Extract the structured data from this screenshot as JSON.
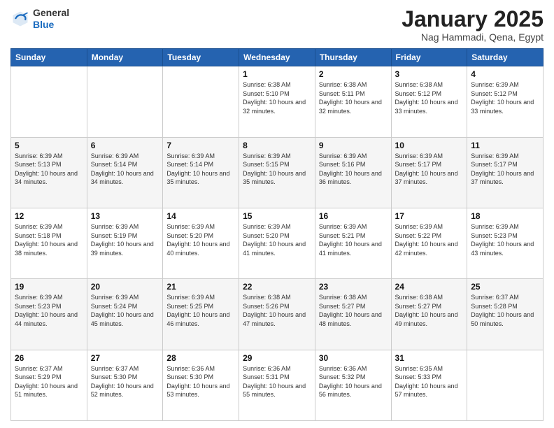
{
  "logo": {
    "general": "General",
    "blue": "Blue"
  },
  "header": {
    "month_year": "January 2025",
    "location": "Nag Hammadi, Qena, Egypt"
  },
  "weekdays": [
    "Sunday",
    "Monday",
    "Tuesday",
    "Wednesday",
    "Thursday",
    "Friday",
    "Saturday"
  ],
  "weeks": [
    [
      {
        "day": "",
        "sunrise": "",
        "sunset": "",
        "daylight": ""
      },
      {
        "day": "",
        "sunrise": "",
        "sunset": "",
        "daylight": ""
      },
      {
        "day": "",
        "sunrise": "",
        "sunset": "",
        "daylight": ""
      },
      {
        "day": "1",
        "sunrise": "Sunrise: 6:38 AM",
        "sunset": "Sunset: 5:10 PM",
        "daylight": "Daylight: 10 hours and 32 minutes."
      },
      {
        "day": "2",
        "sunrise": "Sunrise: 6:38 AM",
        "sunset": "Sunset: 5:11 PM",
        "daylight": "Daylight: 10 hours and 32 minutes."
      },
      {
        "day": "3",
        "sunrise": "Sunrise: 6:38 AM",
        "sunset": "Sunset: 5:12 PM",
        "daylight": "Daylight: 10 hours and 33 minutes."
      },
      {
        "day": "4",
        "sunrise": "Sunrise: 6:39 AM",
        "sunset": "Sunset: 5:12 PM",
        "daylight": "Daylight: 10 hours and 33 minutes."
      }
    ],
    [
      {
        "day": "5",
        "sunrise": "Sunrise: 6:39 AM",
        "sunset": "Sunset: 5:13 PM",
        "daylight": "Daylight: 10 hours and 34 minutes."
      },
      {
        "day": "6",
        "sunrise": "Sunrise: 6:39 AM",
        "sunset": "Sunset: 5:14 PM",
        "daylight": "Daylight: 10 hours and 34 minutes."
      },
      {
        "day": "7",
        "sunrise": "Sunrise: 6:39 AM",
        "sunset": "Sunset: 5:14 PM",
        "daylight": "Daylight: 10 hours and 35 minutes."
      },
      {
        "day": "8",
        "sunrise": "Sunrise: 6:39 AM",
        "sunset": "Sunset: 5:15 PM",
        "daylight": "Daylight: 10 hours and 35 minutes."
      },
      {
        "day": "9",
        "sunrise": "Sunrise: 6:39 AM",
        "sunset": "Sunset: 5:16 PM",
        "daylight": "Daylight: 10 hours and 36 minutes."
      },
      {
        "day": "10",
        "sunrise": "Sunrise: 6:39 AM",
        "sunset": "Sunset: 5:17 PM",
        "daylight": "Daylight: 10 hours and 37 minutes."
      },
      {
        "day": "11",
        "sunrise": "Sunrise: 6:39 AM",
        "sunset": "Sunset: 5:17 PM",
        "daylight": "Daylight: 10 hours and 37 minutes."
      }
    ],
    [
      {
        "day": "12",
        "sunrise": "Sunrise: 6:39 AM",
        "sunset": "Sunset: 5:18 PM",
        "daylight": "Daylight: 10 hours and 38 minutes."
      },
      {
        "day": "13",
        "sunrise": "Sunrise: 6:39 AM",
        "sunset": "Sunset: 5:19 PM",
        "daylight": "Daylight: 10 hours and 39 minutes."
      },
      {
        "day": "14",
        "sunrise": "Sunrise: 6:39 AM",
        "sunset": "Sunset: 5:20 PM",
        "daylight": "Daylight: 10 hours and 40 minutes."
      },
      {
        "day": "15",
        "sunrise": "Sunrise: 6:39 AM",
        "sunset": "Sunset: 5:20 PM",
        "daylight": "Daylight: 10 hours and 41 minutes."
      },
      {
        "day": "16",
        "sunrise": "Sunrise: 6:39 AM",
        "sunset": "Sunset: 5:21 PM",
        "daylight": "Daylight: 10 hours and 41 minutes."
      },
      {
        "day": "17",
        "sunrise": "Sunrise: 6:39 AM",
        "sunset": "Sunset: 5:22 PM",
        "daylight": "Daylight: 10 hours and 42 minutes."
      },
      {
        "day": "18",
        "sunrise": "Sunrise: 6:39 AM",
        "sunset": "Sunset: 5:23 PM",
        "daylight": "Daylight: 10 hours and 43 minutes."
      }
    ],
    [
      {
        "day": "19",
        "sunrise": "Sunrise: 6:39 AM",
        "sunset": "Sunset: 5:23 PM",
        "daylight": "Daylight: 10 hours and 44 minutes."
      },
      {
        "day": "20",
        "sunrise": "Sunrise: 6:39 AM",
        "sunset": "Sunset: 5:24 PM",
        "daylight": "Daylight: 10 hours and 45 minutes."
      },
      {
        "day": "21",
        "sunrise": "Sunrise: 6:39 AM",
        "sunset": "Sunset: 5:25 PM",
        "daylight": "Daylight: 10 hours and 46 minutes."
      },
      {
        "day": "22",
        "sunrise": "Sunrise: 6:38 AM",
        "sunset": "Sunset: 5:26 PM",
        "daylight": "Daylight: 10 hours and 47 minutes."
      },
      {
        "day": "23",
        "sunrise": "Sunrise: 6:38 AM",
        "sunset": "Sunset: 5:27 PM",
        "daylight": "Daylight: 10 hours and 48 minutes."
      },
      {
        "day": "24",
        "sunrise": "Sunrise: 6:38 AM",
        "sunset": "Sunset: 5:27 PM",
        "daylight": "Daylight: 10 hours and 49 minutes."
      },
      {
        "day": "25",
        "sunrise": "Sunrise: 6:37 AM",
        "sunset": "Sunset: 5:28 PM",
        "daylight": "Daylight: 10 hours and 50 minutes."
      }
    ],
    [
      {
        "day": "26",
        "sunrise": "Sunrise: 6:37 AM",
        "sunset": "Sunset: 5:29 PM",
        "daylight": "Daylight: 10 hours and 51 minutes."
      },
      {
        "day": "27",
        "sunrise": "Sunrise: 6:37 AM",
        "sunset": "Sunset: 5:30 PM",
        "daylight": "Daylight: 10 hours and 52 minutes."
      },
      {
        "day": "28",
        "sunrise": "Sunrise: 6:36 AM",
        "sunset": "Sunset: 5:30 PM",
        "daylight": "Daylight: 10 hours and 53 minutes."
      },
      {
        "day": "29",
        "sunrise": "Sunrise: 6:36 AM",
        "sunset": "Sunset: 5:31 PM",
        "daylight": "Daylight: 10 hours and 55 minutes."
      },
      {
        "day": "30",
        "sunrise": "Sunrise: 6:36 AM",
        "sunset": "Sunset: 5:32 PM",
        "daylight": "Daylight: 10 hours and 56 minutes."
      },
      {
        "day": "31",
        "sunrise": "Sunrise: 6:35 AM",
        "sunset": "Sunset: 5:33 PM",
        "daylight": "Daylight: 10 hours and 57 minutes."
      },
      {
        "day": "",
        "sunrise": "",
        "sunset": "",
        "daylight": ""
      }
    ]
  ]
}
